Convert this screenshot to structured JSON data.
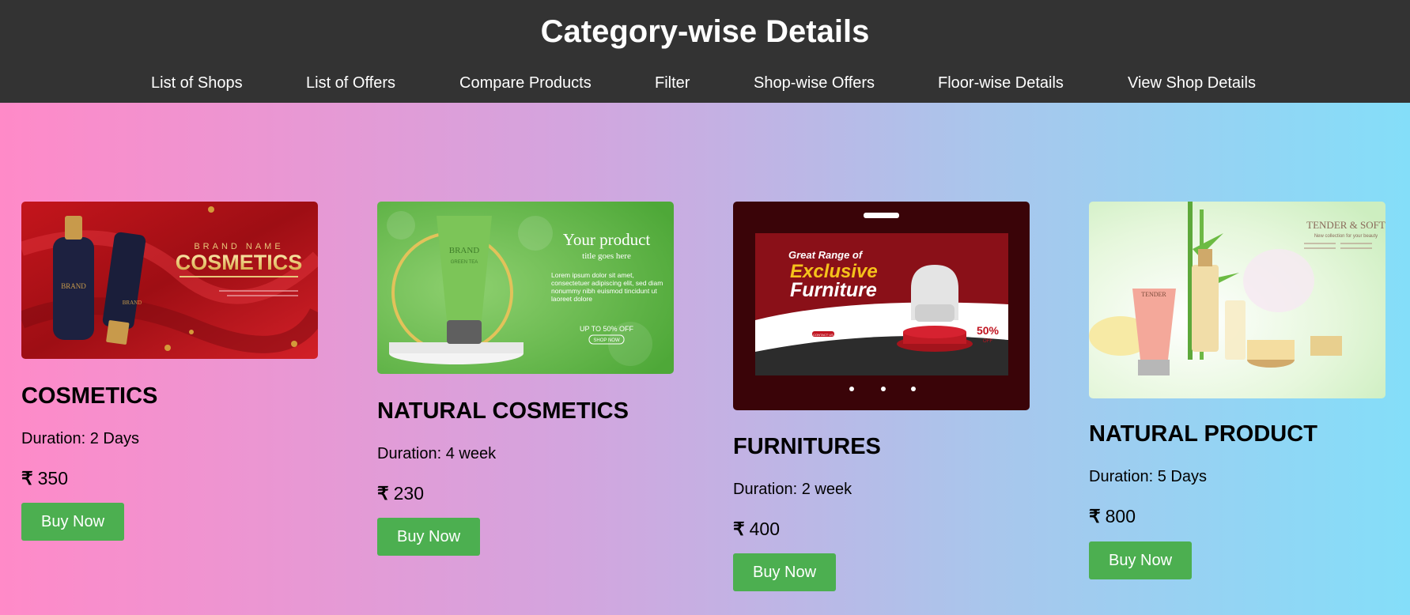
{
  "header": {
    "title": "Category-wise Details",
    "nav": [
      {
        "label": "List of Shops"
      },
      {
        "label": "List of Offers"
      },
      {
        "label": "Compare Products"
      },
      {
        "label": "Filter"
      },
      {
        "label": "Shop-wise Offers"
      },
      {
        "label": "Floor-wise Details"
      },
      {
        "label": "View Shop Details"
      }
    ]
  },
  "colors": {
    "header_bg": "#333333",
    "button_bg": "#4caf50",
    "gradient_start": "#ff8ac8",
    "gradient_end": "#84def9"
  },
  "cards": [
    {
      "title": "COSMETICS",
      "duration": "Duration: 2 Days",
      "currency": "₹",
      "price": "350",
      "button": "Buy Now",
      "image": {
        "brand": "BRAND NAME",
        "headline": "COSMETICS",
        "bottle_label": "BRAND",
        "tube_label": "BRAND"
      }
    },
    {
      "title": "NATURAL COSMETICS",
      "duration": "Duration: 4 week",
      "currency": "₹",
      "price": "230",
      "button": "Buy Now",
      "image": {
        "headline": "Your product",
        "subhead": "title goes here",
        "body": "Lorem ipsum dolor sit amet, consectetuer adipiscing elit, sed diam nonummy nibh euismod tincidunt ut laoreet dolore",
        "offer": "UP TO 50% OFF",
        "cta": "SHOP NOW",
        "tube_label": "BRAND",
        "tube_sub": "GREEN TEA"
      }
    },
    {
      "title": "FURNITURES",
      "duration": "Duration: 2 week",
      "currency": "₹",
      "price": "400",
      "button": "Buy Now",
      "image": {
        "line1": "Great Range of",
        "line2": "Exclusive",
        "line3": "Furniture",
        "discount": "50%",
        "discount_sub": "OFF",
        "cta": "CONTACT US"
      }
    },
    {
      "title": "NATURAL PRODUCT",
      "duration": "Duration: 5 Days",
      "currency": "₹",
      "price": "800",
      "button": "Buy Now",
      "image": {
        "brand": "TENDER & SOFT",
        "subhead": "New collection for your beauty",
        "tube_label": "TENDER"
      }
    }
  ]
}
